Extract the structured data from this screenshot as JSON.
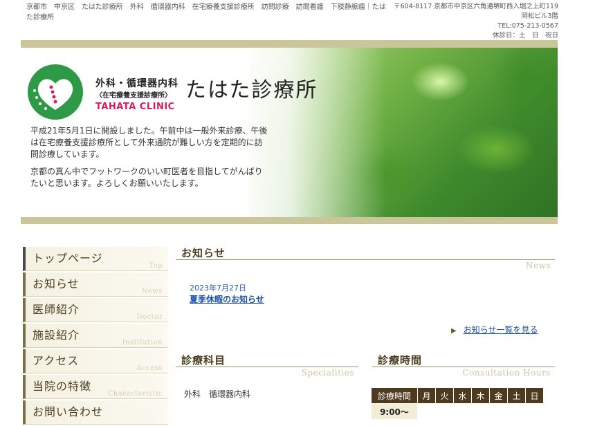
{
  "header": {
    "keywords_line": "京都市　中京区　たはた診療所　外科　循環器内科　在宅療養支援診療所　訪問診療　訪問看護　下肢静脈瘤｜たはた診療所",
    "address": "〒604-8117 京都市中京区六角通堺町西入堀之上町119",
    "building": "岡松ビル3階",
    "tel": "TEL:075-213-0567",
    "closed": "休診日：土　日　祝日"
  },
  "hero": {
    "logo_sub1": "外科・循環器内科",
    "logo_sub2": "〈在宅療養支援診療所〉",
    "logo_en": "TAHATA CLINIC",
    "clinic_name": "たはた診療所",
    "intro_p1": "平成21年5月1日に開設しました。午前中は一般外来診療、午後は在宅療養支援診療所として外来通院が難しい方を定期的に訪問診療しています。",
    "intro_p2": "京都の真ん中でフットワークのいい町医者を目指してがんばりたいと思います。よろしくお願いいたします。"
  },
  "nav": [
    {
      "jp": "トップページ",
      "en": "Top"
    },
    {
      "jp": "お知らせ",
      "en": "News"
    },
    {
      "jp": "医師紹介",
      "en": "Doctor"
    },
    {
      "jp": "施設紹介",
      "en": "Institution"
    },
    {
      "jp": "アクセス",
      "en": "Access"
    },
    {
      "jp": "当院の特徴",
      "en": "Characteristic"
    },
    {
      "jp": "お問い合わせ",
      "en": ""
    }
  ],
  "news": {
    "title": "お知らせ",
    "title_en": "News",
    "items": [
      {
        "date": "2023年7月27日",
        "title": "夏季休暇のお知らせ"
      }
    ],
    "more_label": "お知らせ一覧を見る"
  },
  "specialities": {
    "title": "診療科目",
    "title_en": "Specialities",
    "text": "外科　循環器内科"
  },
  "hours": {
    "title": "診療時間",
    "title_en": "Consultation Hours",
    "header": [
      "診療時間",
      "月",
      "火",
      "水",
      "木",
      "金",
      "土",
      "日"
    ],
    "row1_time": "9:00〜"
  },
  "colors": {
    "accent_bar": "#cbc59b",
    "nav_text": "#4c3f21",
    "table_header": "#4d3a1f",
    "logo_green": "#2e9a47",
    "logo_pink": "#d61e5c",
    "link": "#1a4fa8"
  }
}
